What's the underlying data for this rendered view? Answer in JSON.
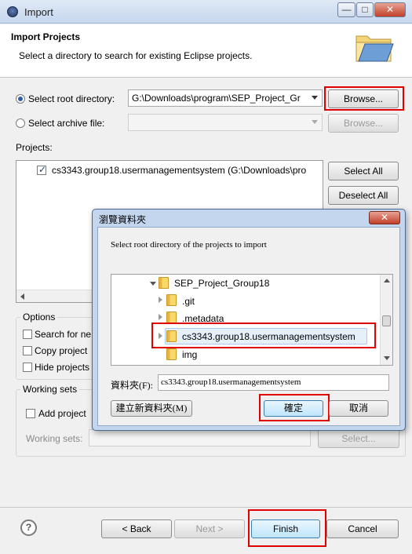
{
  "window": {
    "title": "Import",
    "minimize": "—",
    "maximize": "□",
    "close": "✕"
  },
  "header": {
    "title": "Import Projects",
    "description": "Select a directory to search for existing Eclipse projects."
  },
  "source": {
    "root_dir_label": "Select root directory:",
    "root_dir_value": "G:\\Downloads\\program\\SEP_Project_Gr",
    "browse_label": "Browse...",
    "archive_label": "Select archive file:",
    "archive_browse_label": "Browse..."
  },
  "projects": {
    "label": "Projects:",
    "items": [
      "cs3343.group18.usermanagementsystem (G:\\Downloads\\pro"
    ],
    "select_all": "Select All",
    "deselect_all": "Deselect All"
  },
  "options": {
    "label": "Options",
    "search_nested": "Search for ne",
    "copy_projects": "Copy project",
    "hide_projects": "Hide projects"
  },
  "working_sets": {
    "label": "Working sets",
    "add_project": "Add project",
    "sets_label": "Working sets:",
    "select_label": "Select..."
  },
  "footer": {
    "help": "?",
    "back": "< Back",
    "next": "Next >",
    "finish": "Finish",
    "cancel": "Cancel"
  },
  "dialog": {
    "title": "瀏覽資料夾",
    "close": "✕",
    "prompt": "Select root directory of the projects to import",
    "tree": [
      {
        "label": "SEP_Project_Group18",
        "expanded": true
      },
      {
        "label": ".git",
        "expanded": false
      },
      {
        "label": ".metadata",
        "expanded": false
      },
      {
        "label": "cs3343.group18.usermanagementsystem",
        "expanded": false,
        "selected": true
      },
      {
        "label": "img",
        "expanded": false
      }
    ],
    "folder_label": "資料夾(F):",
    "folder_value": "cs3343.group18.usermanagementsystem",
    "new_folder": "建立新資料夾(M)",
    "ok": "確定",
    "cancel": "取消"
  },
  "colors": {
    "highlight_box": "#e00000",
    "folder": "#f8d868",
    "dialog_frame": "#c4d6ee"
  }
}
